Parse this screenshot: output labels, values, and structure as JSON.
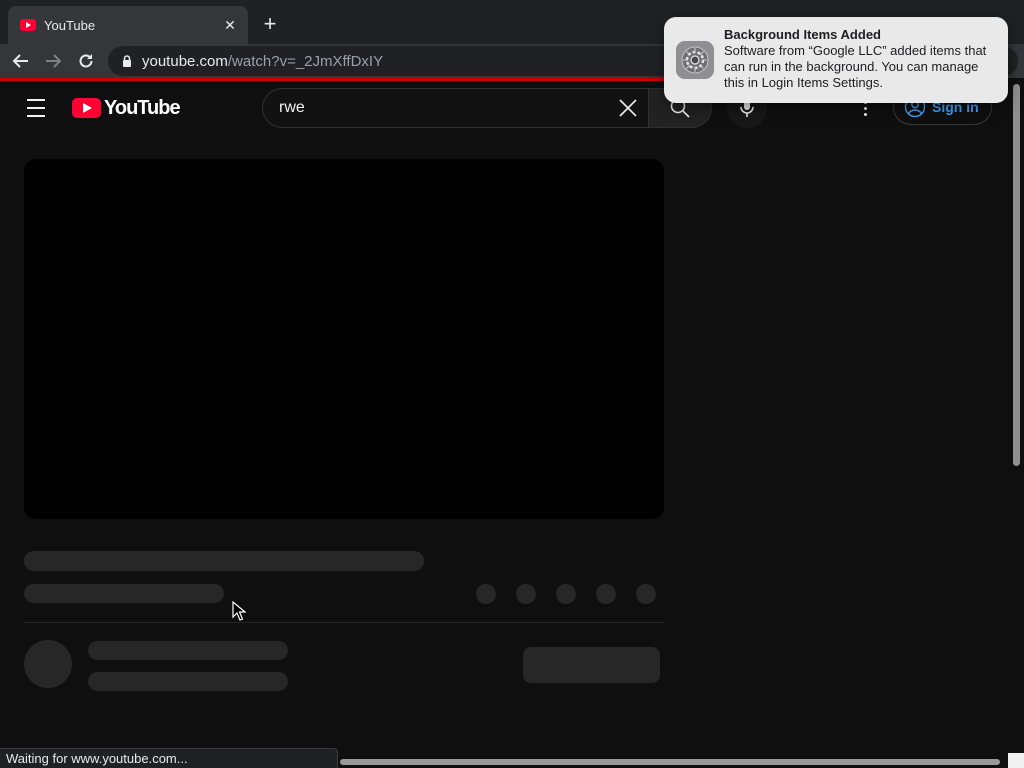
{
  "browser": {
    "tab": {
      "title": "YouTube",
      "close_glyph": "✕",
      "favicon": "youtube-favicon-icon"
    },
    "new_tab_glyph": "+",
    "address": {
      "host": "youtube.com",
      "path": "/watch?v=_2JmXffDxIY"
    },
    "status_text": "Waiting for www.youtube.com...",
    "colors": {
      "load_bar": "#cc0000"
    }
  },
  "youtube": {
    "logo_text": "YouTube",
    "search": {
      "value": "rwe"
    },
    "signin_label": "Sign in",
    "colors": {
      "brand": "#ff0033",
      "link": "#3ea6ff"
    }
  },
  "notification": {
    "title": "Background Items Added",
    "body": "Software from “Google LLC” added items that can run in the background. You can manage this in Login Items Settings.",
    "icon": "system-settings-gear-icon"
  }
}
